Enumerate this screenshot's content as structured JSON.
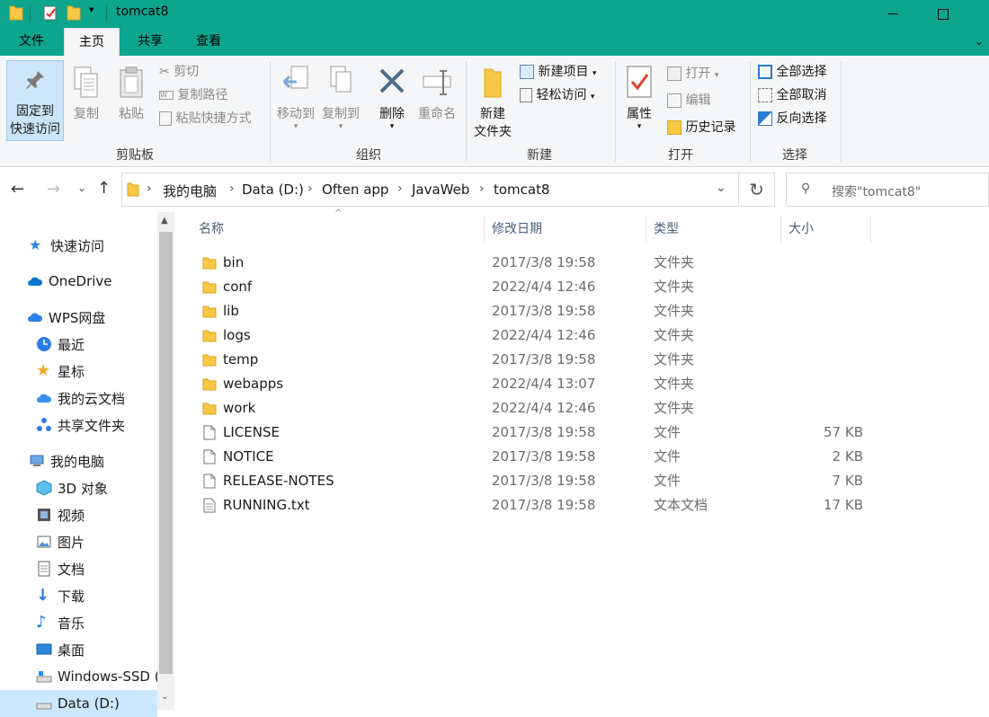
{
  "window": {
    "title": "tomcat8"
  },
  "tabs": [
    {
      "label": "文件"
    },
    {
      "label": "主页"
    },
    {
      "label": "共享"
    },
    {
      "label": "查看"
    }
  ],
  "ribbon": {
    "pin": "固定到快速访问",
    "pin_line1": "固定到",
    "pin_line2": "快速访问",
    "copy": "复制",
    "paste": "粘贴",
    "cut": "剪切",
    "copy_path": "复制路径",
    "paste_shortcut": "粘贴快捷方式",
    "group_clipboard": "剪贴板",
    "move_to": "移动到",
    "copy_to": "复制到",
    "delete": "删除",
    "rename": "重命名",
    "group_organize": "组织",
    "new_folder_line1": "新建",
    "new_folder_line2": "文件夹",
    "new_item": "新建项目",
    "easy_access": "轻松访问",
    "group_new": "新建",
    "properties": "属性",
    "open": "打开",
    "edit": "编辑",
    "history": "历史记录",
    "group_open": "打开",
    "select_all": "全部选择",
    "select_none": "全部取消",
    "invert_select": "反向选择",
    "group_select": "选择"
  },
  "address": {
    "crumbs": [
      "我的电脑",
      "Data (D:)",
      "Often app",
      "JavaWeb",
      "tomcat8"
    ],
    "search_placeholder": "搜索\"tomcat8\""
  },
  "nav": [
    {
      "label": "快速访问",
      "icon": "star-icon"
    },
    {
      "label": "OneDrive",
      "icon": "cloud-icon"
    },
    {
      "label": "WPS网盘",
      "icon": "cloud-icon"
    },
    {
      "label": "最近",
      "icon": "clock-icon"
    },
    {
      "label": "星标",
      "icon": "star-icon"
    },
    {
      "label": "我的云文档",
      "icon": "cloud-icon"
    },
    {
      "label": "共享文件夹",
      "icon": "share-icon"
    },
    {
      "label": "我的电脑",
      "icon": "computer-icon"
    },
    {
      "label": "3D 对象",
      "icon": "cube-icon"
    },
    {
      "label": "视频",
      "icon": "video-icon"
    },
    {
      "label": "图片",
      "icon": "picture-icon"
    },
    {
      "label": "文档",
      "icon": "document-icon"
    },
    {
      "label": "下载",
      "icon": "download-icon"
    },
    {
      "label": "音乐",
      "icon": "music-icon"
    },
    {
      "label": "桌面",
      "icon": "desktop-icon"
    },
    {
      "label": "Windows-SSD (",
      "icon": "drive-icon"
    },
    {
      "label": "Data (D:)",
      "icon": "drive-icon"
    }
  ],
  "columns": {
    "name": "名称",
    "date": "修改日期",
    "type": "类型",
    "size": "大小"
  },
  "files": [
    {
      "name": "bin",
      "date": "2017/3/8 19:58",
      "type": "文件夹",
      "size": "",
      "kind": "folder"
    },
    {
      "name": "conf",
      "date": "2022/4/4 12:46",
      "type": "文件夹",
      "size": "",
      "kind": "folder"
    },
    {
      "name": "lib",
      "date": "2017/3/8 19:58",
      "type": "文件夹",
      "size": "",
      "kind": "folder"
    },
    {
      "name": "logs",
      "date": "2022/4/4 12:46",
      "type": "文件夹",
      "size": "",
      "kind": "folder"
    },
    {
      "name": "temp",
      "date": "2017/3/8 19:58",
      "type": "文件夹",
      "size": "",
      "kind": "folder"
    },
    {
      "name": "webapps",
      "date": "2022/4/4 13:07",
      "type": "文件夹",
      "size": "",
      "kind": "folder"
    },
    {
      "name": "work",
      "date": "2022/4/4 12:46",
      "type": "文件夹",
      "size": "",
      "kind": "folder"
    },
    {
      "name": "LICENSE",
      "date": "2017/3/8 19:58",
      "type": "文件",
      "size": "57 KB",
      "kind": "file"
    },
    {
      "name": "NOTICE",
      "date": "2017/3/8 19:58",
      "type": "文件",
      "size": "2 KB",
      "kind": "file"
    },
    {
      "name": "RELEASE-NOTES",
      "date": "2017/3/8 19:58",
      "type": "文件",
      "size": "7 KB",
      "kind": "file"
    },
    {
      "name": "RUNNING.txt",
      "date": "2017/3/8 19:58",
      "type": "文本文档",
      "size": "17 KB",
      "kind": "text"
    }
  ],
  "colors": {
    "titlebar": "#0ea58d",
    "folder": "#f8c845",
    "accent": "#0078d7"
  }
}
